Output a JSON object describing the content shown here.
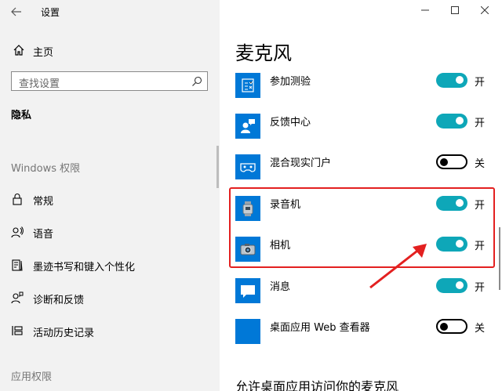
{
  "window": {
    "title": "设置",
    "back_icon": "back-arrow-icon",
    "controls": [
      "minimize",
      "maximize",
      "close"
    ]
  },
  "sidebar": {
    "home_label": "主页",
    "search_placeholder": "查找设置",
    "section_privacy": "隐私",
    "section_windows": "Windows 权限",
    "items": [
      {
        "label": "常规",
        "icon": "lock-icon"
      },
      {
        "label": "语音",
        "icon": "speech-icon"
      },
      {
        "label": "墨迹书写和键入个性化",
        "icon": "clipboard-pen-icon"
      },
      {
        "label": "诊断和反馈",
        "icon": "feedback-person-icon"
      },
      {
        "label": "活动历史记录",
        "icon": "timeline-icon"
      }
    ],
    "section_app": "应用权限"
  },
  "main": {
    "title": "麦克风",
    "apps": [
      {
        "name": "参加测验",
        "icon": "quiz-icon",
        "toggle_on": true,
        "state_label": "开"
      },
      {
        "name": "反馈中心",
        "icon": "feedback-hub-icon",
        "toggle_on": true,
        "state_label": "开"
      },
      {
        "name": "混合现实门户",
        "icon": "mixed-reality-icon",
        "toggle_on": false,
        "state_label": "关"
      },
      {
        "name": "录音机",
        "icon": "voice-recorder-icon",
        "toggle_on": true,
        "state_label": "开"
      },
      {
        "name": "相机",
        "icon": "camera-icon",
        "toggle_on": true,
        "state_label": "开"
      },
      {
        "name": "消息",
        "icon": "message-icon",
        "toggle_on": true,
        "state_label": "开"
      },
      {
        "name": "桌面应用 Web 查看器",
        "icon": "web-viewer-icon",
        "toggle_on": false,
        "state_label": "关"
      }
    ],
    "bottom_heading": "允许桌面应用访问你的麦克风"
  },
  "colors": {
    "accent_toggle": "#0ea7b8",
    "app_tile": "#0078d7",
    "annotation_red": "#e32020",
    "sidebar_bg": "#f2f2f2"
  }
}
